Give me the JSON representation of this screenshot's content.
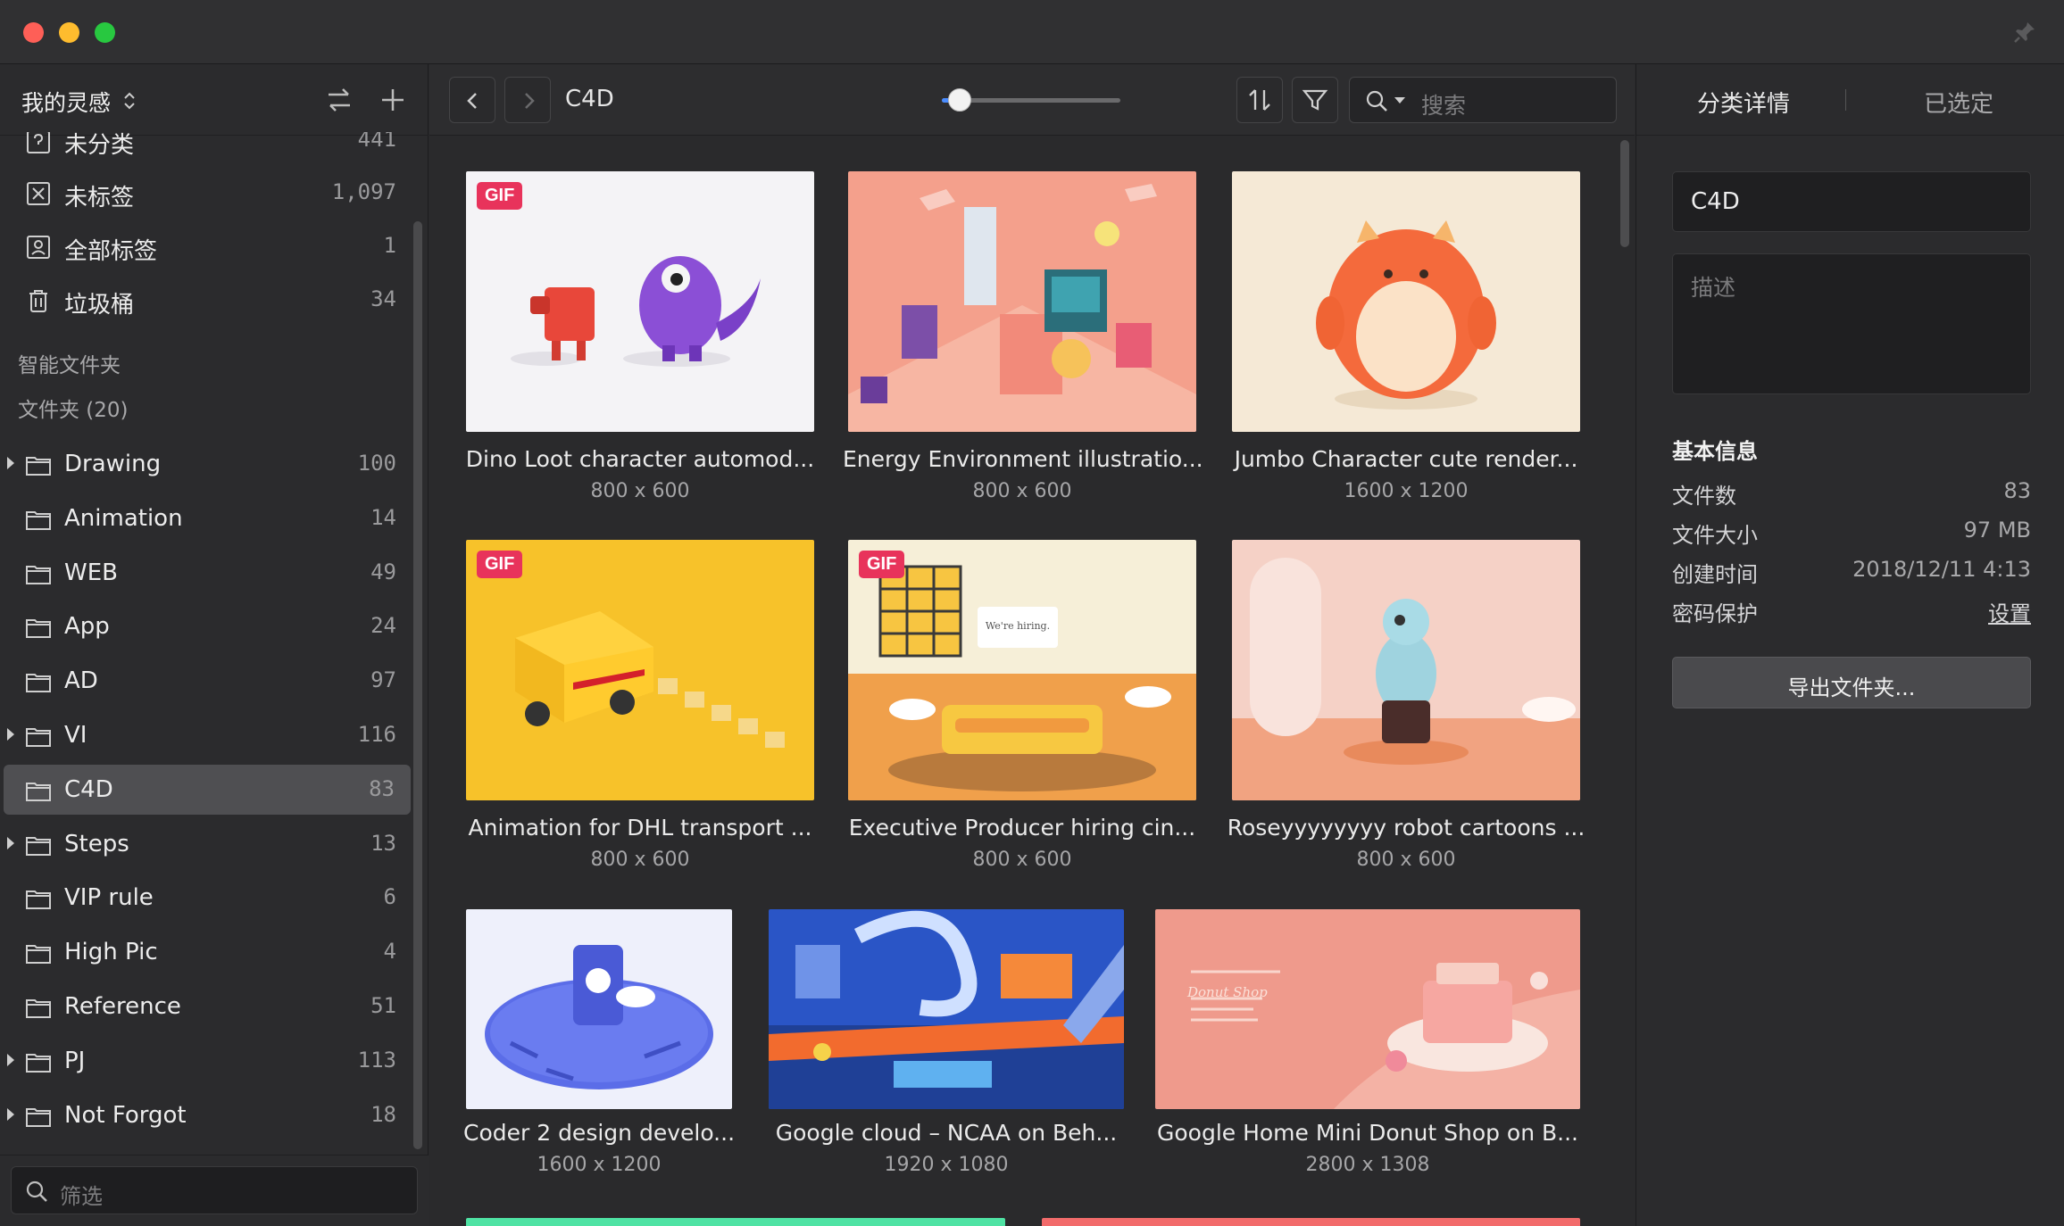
{
  "library": {
    "title": "我的灵感",
    "chevron": "⌃⌄"
  },
  "sidebar": {
    "top_items": [
      {
        "label": "未分类",
        "count": "441",
        "icon": "question-icon"
      },
      {
        "label": "未标签",
        "count": "1,097",
        "icon": "untagged-icon"
      },
      {
        "label": "全部标签",
        "count": "1",
        "icon": "tags-icon"
      },
      {
        "label": "垃圾桶",
        "count": "34",
        "icon": "trash-icon"
      }
    ],
    "smart_folders_label": "智能文件夹",
    "folders_label": "文件夹 (20)",
    "folders": [
      {
        "label": "Drawing",
        "count": "100",
        "expandable": true
      },
      {
        "label": "Animation",
        "count": "14",
        "expandable": false
      },
      {
        "label": "WEB",
        "count": "49",
        "expandable": false
      },
      {
        "label": "App",
        "count": "24",
        "expandable": false
      },
      {
        "label": "AD",
        "count": "97",
        "expandable": false
      },
      {
        "label": "VI",
        "count": "116",
        "expandable": true
      },
      {
        "label": "C4D",
        "count": "83",
        "expandable": false,
        "active": true
      },
      {
        "label": "Steps",
        "count": "13",
        "expandable": true
      },
      {
        "label": "VIP rule",
        "count": "6",
        "expandable": false
      },
      {
        "label": "High Pic",
        "count": "4",
        "expandable": false
      },
      {
        "label": "Reference",
        "count": "51",
        "expandable": false
      },
      {
        "label": "PJ",
        "count": "113",
        "expandable": true
      },
      {
        "label": "Not Forgot",
        "count": "18",
        "expandable": true
      }
    ],
    "filter_placeholder": "筛选"
  },
  "toolbar": {
    "breadcrumb": "C4D",
    "zoom_level": 0.1,
    "search_placeholder": "搜索"
  },
  "grid": {
    "items": [
      {
        "title": "Dino Loot character automod...",
        "dims": "800 x 600",
        "gif": true,
        "badge": "GIF"
      },
      {
        "title": "Energy Environment illustratio...",
        "dims": "800 x 600",
        "gif": false
      },
      {
        "title": "Jumbo Character cute render...",
        "dims": "1600 x 1200",
        "gif": false
      },
      {
        "title": "Animation for DHL transport ...",
        "dims": "800 x 600",
        "gif": true,
        "badge": "GIF"
      },
      {
        "title": "Executive Producer hiring cin...",
        "dims": "800 x 600",
        "gif": true,
        "badge": "GIF",
        "sign_text": "We're hiring."
      },
      {
        "title": "Roseyyyyyyyy robot cartoons ...",
        "dims": "800 x 600",
        "gif": false
      },
      {
        "title": "Coder 2 design develo...",
        "dims": "1600 x 1200",
        "gif": false
      },
      {
        "title": "Google cloud – NCAA on Beh...",
        "dims": "1920 x 1080",
        "gif": false
      },
      {
        "title": "Google Home Mini Donut Shop on B...",
        "dims": "2800 x 1308",
        "gif": false,
        "sign_text": "Donut Shop"
      }
    ]
  },
  "inspector": {
    "tab_details": "分类详情",
    "tab_selected": "已选定",
    "name": "C4D",
    "desc_placeholder": "描述",
    "basic_info": "基本信息",
    "rows": [
      {
        "k": "文件数",
        "v": "83"
      },
      {
        "k": "文件大小",
        "v": "97 MB"
      },
      {
        "k": "创建时间",
        "v": "2018/12/11 4:13"
      },
      {
        "k": "密码保护",
        "v": "设置"
      }
    ],
    "export_label": "导出文件夹..."
  },
  "colors": {
    "accent": "#4a8cff",
    "gif_badge": "#e8335b",
    "active_row": "#4f4f52"
  }
}
